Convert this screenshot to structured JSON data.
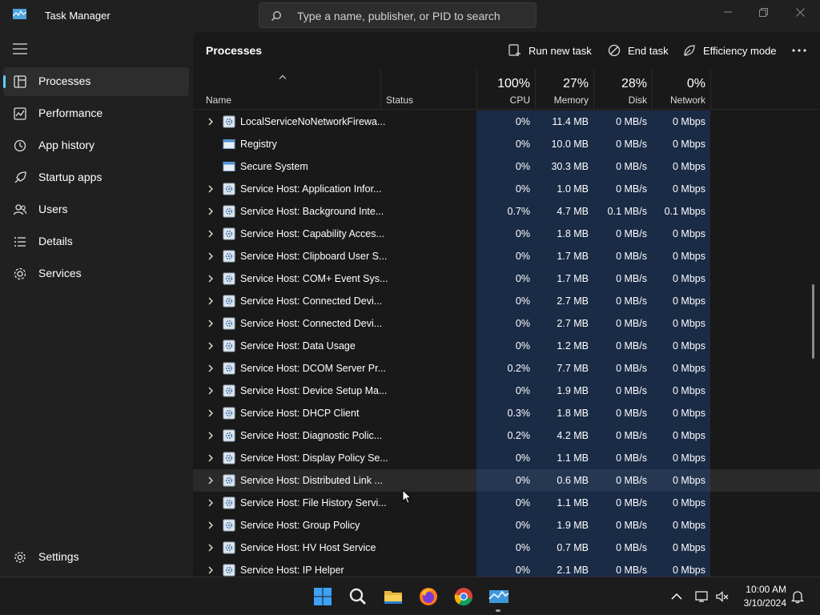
{
  "window": {
    "title": "Task Manager",
    "search_placeholder": "Type a name, publisher, or PID to search"
  },
  "sidebar": {
    "items": [
      {
        "label": "Processes",
        "icon": "processes-icon",
        "active": true
      },
      {
        "label": "Performance",
        "icon": "performance-icon"
      },
      {
        "label": "App history",
        "icon": "app-history-icon"
      },
      {
        "label": "Startup apps",
        "icon": "startup-apps-icon"
      },
      {
        "label": "Users",
        "icon": "users-icon"
      },
      {
        "label": "Details",
        "icon": "details-icon"
      },
      {
        "label": "Services",
        "icon": "services-icon"
      }
    ],
    "settings_label": "Settings"
  },
  "header": {
    "title": "Processes",
    "run_new_task": "Run new task",
    "end_task": "End task",
    "efficiency_mode": "Efficiency mode"
  },
  "columns": {
    "name": "Name",
    "status": "Status",
    "cpu": {
      "percent": "100%",
      "label": "CPU"
    },
    "memory": {
      "percent": "27%",
      "label": "Memory"
    },
    "disk": {
      "percent": "28%",
      "label": "Disk"
    },
    "network": {
      "percent": "0%",
      "label": "Network"
    }
  },
  "colors": {
    "accent": "#60cdff",
    "heat_fill": "#1a2b46",
    "background": "#191919"
  },
  "rows": [
    {
      "name": "LocalServiceNoNetworkFirewa...",
      "icon": "service-host-icon",
      "expandable": true,
      "cpu": "0%",
      "memory": "11.4 MB",
      "disk": "0 MB/s",
      "network": "0 Mbps"
    },
    {
      "name": "Registry",
      "icon": "window-app-icon",
      "expandable": false,
      "cpu": "0%",
      "memory": "10.0 MB",
      "disk": "0 MB/s",
      "network": "0 Mbps"
    },
    {
      "name": "Secure System",
      "icon": "window-app-icon",
      "expandable": false,
      "cpu": "0%",
      "memory": "30.3 MB",
      "disk": "0 MB/s",
      "network": "0 Mbps"
    },
    {
      "name": "Service Host: Application Infor...",
      "icon": "service-host-icon",
      "expandable": true,
      "cpu": "0%",
      "memory": "1.0 MB",
      "disk": "0 MB/s",
      "network": "0 Mbps"
    },
    {
      "name": "Service Host: Background Inte...",
      "icon": "service-host-icon",
      "expandable": true,
      "cpu": "0.7%",
      "memory": "4.7 MB",
      "disk": "0.1 MB/s",
      "network": "0.1 Mbps"
    },
    {
      "name": "Service Host: Capability Acces...",
      "icon": "service-host-icon",
      "expandable": true,
      "cpu": "0%",
      "memory": "1.8 MB",
      "disk": "0 MB/s",
      "network": "0 Mbps"
    },
    {
      "name": "Service Host: Clipboard User S...",
      "icon": "service-host-icon",
      "expandable": true,
      "cpu": "0%",
      "memory": "1.7 MB",
      "disk": "0 MB/s",
      "network": "0 Mbps"
    },
    {
      "name": "Service Host: COM+ Event Sys...",
      "icon": "service-host-icon",
      "expandable": true,
      "cpu": "0%",
      "memory": "1.7 MB",
      "disk": "0 MB/s",
      "network": "0 Mbps"
    },
    {
      "name": "Service Host: Connected Devi...",
      "icon": "service-host-icon",
      "expandable": true,
      "cpu": "0%",
      "memory": "2.7 MB",
      "disk": "0 MB/s",
      "network": "0 Mbps"
    },
    {
      "name": "Service Host: Connected Devi...",
      "icon": "service-host-icon",
      "expandable": true,
      "cpu": "0%",
      "memory": "2.7 MB",
      "disk": "0 MB/s",
      "network": "0 Mbps"
    },
    {
      "name": "Service Host: Data Usage",
      "icon": "service-host-icon",
      "expandable": true,
      "cpu": "0%",
      "memory": "1.2 MB",
      "disk": "0 MB/s",
      "network": "0 Mbps"
    },
    {
      "name": "Service Host: DCOM Server Pr...",
      "icon": "service-host-icon",
      "expandable": true,
      "cpu": "0.2%",
      "memory": "7.7 MB",
      "disk": "0 MB/s",
      "network": "0 Mbps"
    },
    {
      "name": "Service Host: Device Setup Ma...",
      "icon": "service-host-icon",
      "expandable": true,
      "cpu": "0%",
      "memory": "1.9 MB",
      "disk": "0 MB/s",
      "network": "0 Mbps"
    },
    {
      "name": "Service Host: DHCP Client",
      "icon": "service-host-icon",
      "expandable": true,
      "cpu": "0.3%",
      "memory": "1.8 MB",
      "disk": "0 MB/s",
      "network": "0 Mbps"
    },
    {
      "name": "Service Host: Diagnostic Polic...",
      "icon": "service-host-icon",
      "expandable": true,
      "cpu": "0.2%",
      "memory": "4.2 MB",
      "disk": "0 MB/s",
      "network": "0 Mbps"
    },
    {
      "name": "Service Host: Display Policy Se...",
      "icon": "service-host-icon",
      "expandable": true,
      "cpu": "0%",
      "memory": "1.1 MB",
      "disk": "0 MB/s",
      "network": "0 Mbps"
    },
    {
      "name": "Service Host: Distributed Link ...",
      "icon": "service-host-icon",
      "expandable": true,
      "hover": true,
      "cpu": "0%",
      "memory": "0.6 MB",
      "disk": "0 MB/s",
      "network": "0 Mbps"
    },
    {
      "name": "Service Host: File History Servi...",
      "icon": "service-host-icon",
      "expandable": true,
      "cpu": "0%",
      "memory": "1.1 MB",
      "disk": "0 MB/s",
      "network": "0 Mbps"
    },
    {
      "name": "Service Host: Group Policy",
      "icon": "service-host-icon",
      "expandable": true,
      "cpu": "0%",
      "memory": "1.9 MB",
      "disk": "0 MB/s",
      "network": "0 Mbps"
    },
    {
      "name": "Service Host: HV Host Service",
      "icon": "service-host-icon",
      "expandable": true,
      "cpu": "0%",
      "memory": "0.7 MB",
      "disk": "0 MB/s",
      "network": "0 Mbps"
    },
    {
      "name": "Service Host: IP Helper",
      "icon": "service-host-icon",
      "expandable": true,
      "cpu": "0%",
      "memory": "2.1 MB",
      "disk": "0 MB/s",
      "network": "0 Mbps"
    }
  ],
  "taskbar": {
    "apps": [
      "start-icon",
      "search-icon",
      "file-explorer-icon",
      "firefox-icon",
      "chrome-icon",
      "task-manager-icon"
    ],
    "time": "10:00 AM",
    "date": "3/10/2024"
  }
}
